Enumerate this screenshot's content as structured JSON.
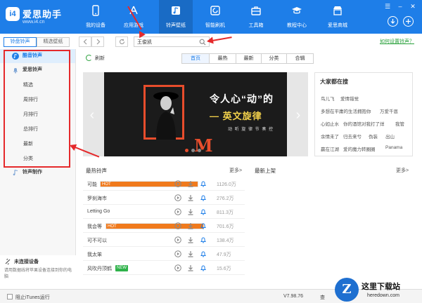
{
  "app": {
    "name": "爱思助手",
    "url": "www.i4.cn"
  },
  "nav": {
    "tabs": [
      {
        "label": "我的设备",
        "icon": "phone-icon"
      },
      {
        "label": "应用游戏",
        "icon": "appstore-icon"
      },
      {
        "label": "铃声壁纸",
        "icon": "music-note-icon"
      },
      {
        "label": "智能刷机",
        "icon": "flash-icon"
      },
      {
        "label": "工具箱",
        "icon": "toolbox-icon"
      },
      {
        "label": "教程中心",
        "icon": "graduation-cap-icon"
      },
      {
        "label": "爱思商城",
        "icon": "shop-icon"
      }
    ],
    "active_index": 2
  },
  "subtabs": [
    "铃盘铃声",
    "精选壁纸"
  ],
  "search": {
    "value": "王俊凯"
  },
  "settings_link": "如何设置铃声？",
  "sidebar": {
    "items": [
      {
        "label": "酷音铃声",
        "type": "top",
        "icon": "music-disc-icon"
      },
      {
        "label": "爱思铃声",
        "type": "top",
        "icon": "bell-icon"
      },
      {
        "label": "精选",
        "type": "sub"
      },
      {
        "label": "周排行",
        "type": "sub"
      },
      {
        "label": "月排行",
        "type": "sub"
      },
      {
        "label": "总排行",
        "type": "sub"
      },
      {
        "label": "最新",
        "type": "sub"
      },
      {
        "label": "分类",
        "type": "sub"
      },
      {
        "label": "铃声制作",
        "type": "top",
        "icon": "music-edit-icon"
      }
    ],
    "active_index": 0
  },
  "device": {
    "title": "未连接设备",
    "desc": "请用数据线将苹果设备连接到你的电脑"
  },
  "content_tabs": [
    "首页",
    "最热",
    "最新",
    "分类",
    "合辑"
  ],
  "refresh_label": "刷新",
  "banner": {
    "headline": "令人心“动”的",
    "subline": "— 英文旋律",
    "tagline": "动 听 旋 律   节 奏 控",
    "letter": "M"
  },
  "hot_search": {
    "title": "大家都在搜",
    "keywords": [
      [
        "鸟儿飞",
        "爱情错觉"
      ],
      [
        "多想在平庸的生活拥抱你",
        "万爱千恩"
      ],
      [
        "心如止水",
        "你的酒馆对我打了烊",
        "我管"
      ],
      [
        "余情未了",
        "归去来兮",
        "伪装",
        "出山"
      ],
      [
        "赢在江湖",
        "爱的魔力转圈圈",
        "Panama"
      ]
    ]
  },
  "hottest": {
    "title": "最热铃声",
    "more": "更多>",
    "rows": [
      {
        "name": "可能",
        "tag": "HOT",
        "count": "1126.0万"
      },
      {
        "name": "罗刹海市",
        "tag": "",
        "count": "276.2万"
      },
      {
        "name": "Letting Go",
        "tag": "",
        "count": "811.3万"
      },
      {
        "name": "我会等",
        "tag": "HOT",
        "count": "701.6万"
      },
      {
        "name": "可不可以",
        "tag": "",
        "count": "138.4万"
      },
      {
        "name": "我太笨",
        "tag": "",
        "count": "47.9万"
      },
      {
        "name": "风吹丹顶鹤",
        "tag": "NEW",
        "count": "15.6万"
      }
    ]
  },
  "newest": {
    "title": "最新上架",
    "more": "更多>"
  },
  "status": {
    "itunes": "阻止iTunes运行",
    "version": "V7.98.76",
    "check": "查"
  },
  "watermark": {
    "cn": "这里下载站",
    "en": "heredown.com"
  },
  "colors": {
    "brand": "#1e7ee8",
    "callout": "#e5292b",
    "hot_tag": "#f07a1c",
    "new_tag": "#2fb24a",
    "link": "#2aa13c"
  }
}
